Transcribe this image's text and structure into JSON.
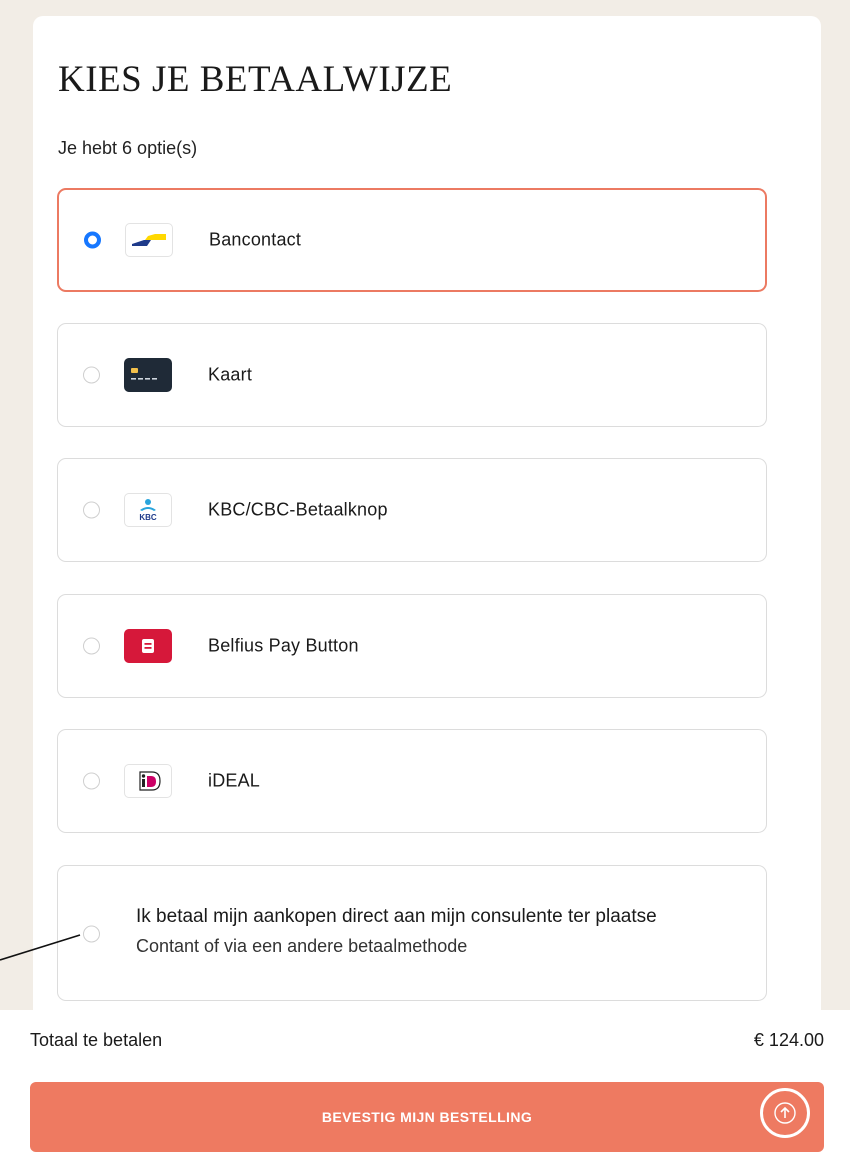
{
  "page": {
    "title": "KIES JE BETAALWIJZE",
    "subtitle": "Je hebt 6 optie(s)"
  },
  "options": [
    {
      "label": "Bancontact",
      "icon": "bancontact-logo-icon",
      "selected": true
    },
    {
      "label": "Kaart",
      "icon": "card-logo-icon",
      "selected": false
    },
    {
      "label": "KBC/CBC-Betaalknop",
      "icon": "kbc-logo-icon",
      "selected": false
    },
    {
      "label": "Belfius Pay Button",
      "icon": "belfius-logo-icon",
      "selected": false
    },
    {
      "label": "iDEAL",
      "icon": "ideal-logo-icon",
      "selected": false
    },
    {
      "label": "Ik betaal mijn aankopen direct aan mijn consulente ter plaatse",
      "description": "Contant of via een andere betaalmethode",
      "selected": false
    }
  ],
  "footer": {
    "total_label": "Totaal te betalen",
    "total_value": "€ 124.00",
    "confirm_label": "BEVESTIG MIJN BESTELLING"
  },
  "colors": {
    "accent": "#ee7a61",
    "radio_selected": "#1677ff",
    "background": "#f2ede6"
  }
}
